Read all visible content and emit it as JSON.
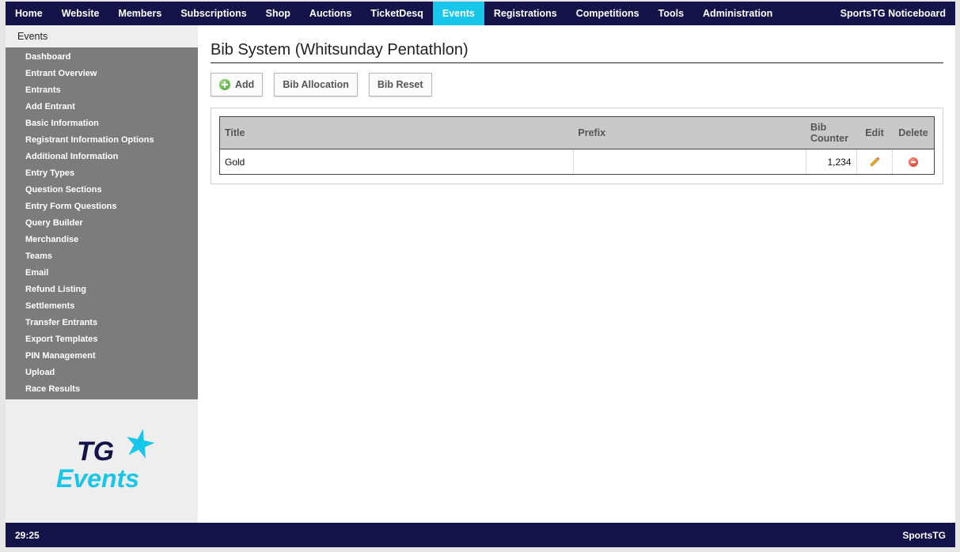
{
  "topnav": {
    "items": [
      "Home",
      "Website",
      "Members",
      "Subscriptions",
      "Shop",
      "Auctions",
      "TicketDesq",
      "Events",
      "Registrations",
      "Competitions",
      "Tools",
      "Administration"
    ],
    "active": "Events",
    "right": "SportsTG Noticeboard",
    "active_color": "#18c6ea",
    "bar_color": "#13134a"
  },
  "sidebar": {
    "title": "Events",
    "items": [
      "Dashboard",
      "Entrant Overview",
      "Entrants",
      "Add Entrant",
      "Basic Information",
      "Registrant Information Options",
      "Additional Information",
      "Entry Types",
      "Question Sections",
      "Entry Form Questions",
      "Query Builder",
      "Merchandise",
      "Teams",
      "Email",
      "Refund Listing",
      "Settlements",
      "Transfer Entrants",
      "Export Templates",
      "PIN Management",
      "Upload",
      "Race Results"
    ],
    "logo": {
      "line1": "TG",
      "line2": "Events"
    }
  },
  "main": {
    "page_title": "Bib System (Whitsunday Pentathlon)",
    "buttons": {
      "add": "Add",
      "bib_allocation": "Bib Allocation",
      "bib_reset": "Bib Reset"
    },
    "table": {
      "headers": {
        "title": "Title",
        "prefix": "Prefix",
        "counter_line1": "Bib",
        "counter_line2": "Counter",
        "edit": "Edit",
        "delete": "Delete"
      },
      "rows": [
        {
          "title": "Gold",
          "prefix": "",
          "counter": "1,234"
        }
      ]
    }
  },
  "footer": {
    "left": "29:25",
    "right": "SportsTG"
  }
}
